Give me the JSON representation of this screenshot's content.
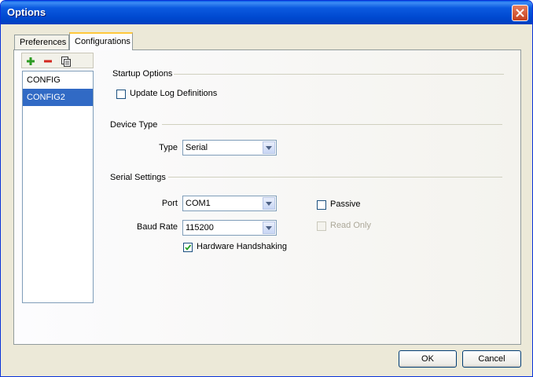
{
  "window": {
    "title": "Options"
  },
  "tabs": [
    {
      "label": "Preferences",
      "active": false
    },
    {
      "label": "Configurations",
      "active": true
    }
  ],
  "toolbar": {
    "add_icon": "plus-icon",
    "remove_icon": "minus-icon",
    "copy_icon": "copy-icon"
  },
  "config_list": {
    "items": [
      "CONFIG",
      "CONFIG2"
    ],
    "selected": "CONFIG2"
  },
  "startup": {
    "group_label": "Startup Options",
    "update_log_label": "Update Log Definitions",
    "update_log_checked": false
  },
  "device": {
    "group_label": "Device Type",
    "type_label": "Type",
    "type_value": "Serial"
  },
  "serial": {
    "group_label": "Serial Settings",
    "port_label": "Port",
    "port_value": "COM1",
    "baud_label": "Baud Rate",
    "baud_value": "115200",
    "handshake_label": "Hardware Handshaking",
    "handshake_checked": true,
    "passive_label": "Passive",
    "passive_checked": false,
    "readonly_label": "Read Only",
    "readonly_checked": false
  },
  "buttons": {
    "ok": "OK",
    "cancel": "Cancel"
  },
  "colors": {
    "title_bar": "#0054E3",
    "selection": "#316AC5",
    "dialog_bg": "#ECE9D8",
    "tab_highlight": "#FFC83C"
  }
}
